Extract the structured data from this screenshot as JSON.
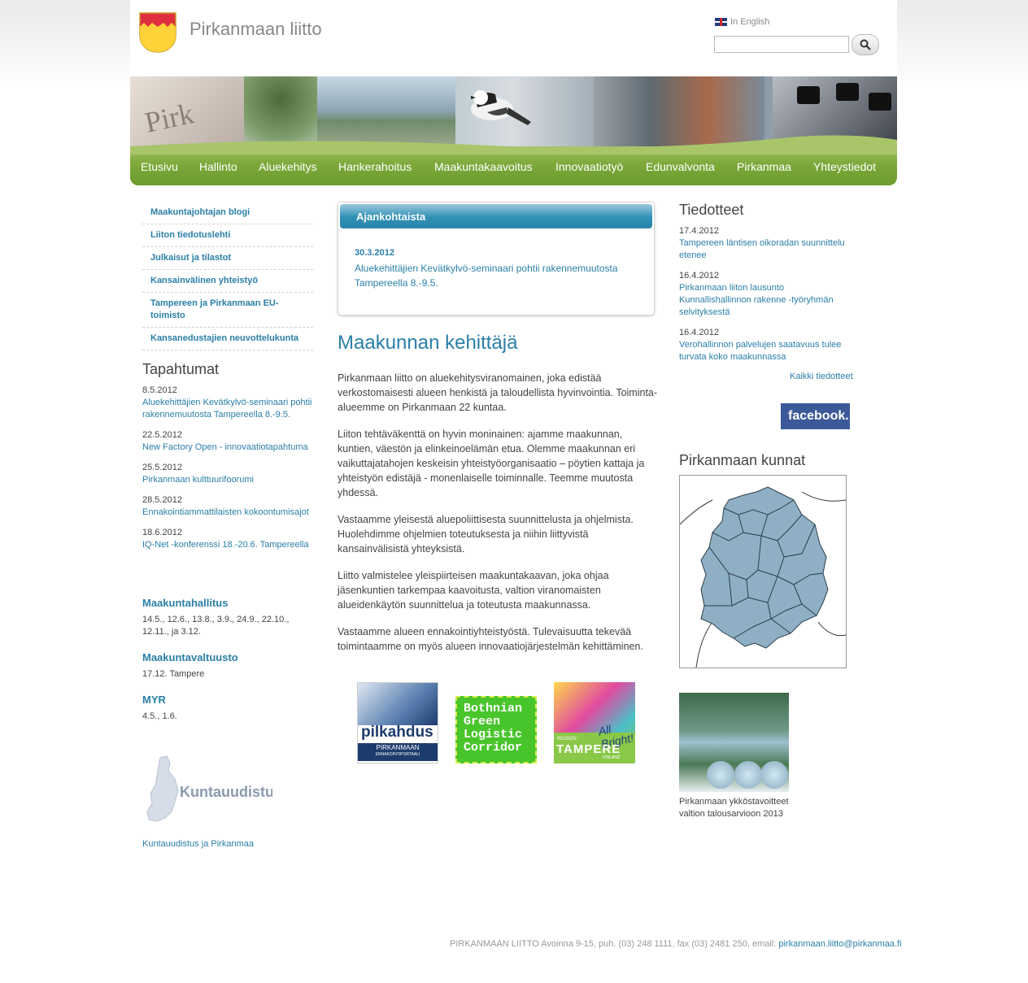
{
  "header": {
    "site_title": "Pirkanmaan liitto",
    "lang_link": "In English",
    "search_placeholder": ""
  },
  "nav": {
    "items": [
      "Etusivu",
      "Hallinto",
      "Aluekehitys",
      "Hankerahoitus",
      "Maakuntakaavoitus",
      "Innovaatiotyö",
      "Edunvalvonta",
      "Pirkanmaa",
      "Yhteystiedot"
    ]
  },
  "left": {
    "links": [
      "Maakuntajohtajan blogi",
      "Liiton tiedotuslehti",
      "Julkaisut ja tilastot",
      "Kansainvälinen yhteistyö",
      "Tampereen ja Pirkanmaan EU-toimisto",
      "Kansanedustajien neuvottelukunta"
    ],
    "events_title": "Tapahtumat",
    "events": [
      {
        "date": "8.5.2012",
        "title": "Aluekehittäjien Kevätkylvö-seminaari pohtii rakennemuutosta Tampereella 8.-9.5."
      },
      {
        "date": "22.5.2012",
        "title": "New Factory Open - innovaatiotapahtuma"
      },
      {
        "date": "25.5.2012",
        "title": "Pirkanmaan kulttuurifoorumi"
      },
      {
        "date": "28.5.2012",
        "title": "Ennakointiammattilaisten kokoontumisajot"
      },
      {
        "date": "18.6.2012",
        "title": "IQ-Net -konferenssi 18.-20.6. Tampereella"
      }
    ],
    "meetings": [
      {
        "title": "Maakuntahallitus",
        "dates": "14.5., 12.6., 13.8., 3.9., 24.9., 22.10., 12.11., ja 3.12."
      },
      {
        "title": "Maakuntavaltuusto",
        "dates": "17.12. Tampere"
      },
      {
        "title": "MYR",
        "dates": "4.5., 1.6."
      }
    ],
    "kunta_image_text": "Kuntauudistus",
    "kunta_link": "Kuntauudistus ja Pirkanmaa"
  },
  "center": {
    "news_header": "Ajankohtaista",
    "news_date": "30.3.2012",
    "news_text": "Aluekehittäjien Kevätkylvö-seminaari pohtii rakennemuutosta Tampereella 8.-9.5.",
    "main_heading": "Maakunnan kehittäjä",
    "paragraphs": [
      "Pirkanmaan liitto on aluekehitysviranomainen, joka edistää verkostomaisesti alueen henkistä ja taloudellista hyvinvointia. Toiminta-alueemme on Pirkanmaan 22 kuntaa.",
      "Liiton tehtäväkenttä on hyvin moninainen: ajamme maakunnan, kuntien, väestön ja elinkeinoelämän etua. Olemme maakunnan eri vaikuttajatahojen keskeisin yhteistyöorganisaatio – pöytien kattaja ja yhteistyön edistäjä - monenlaiselle toiminnalle. Teemme muutosta yhdessä.",
      "Vastaamme yleisestä aluepoliittisesta suunnittelusta ja ohjelmista. Huolehdimme ohjelmien toteutuksesta ja niihin liittyvistä kansainvälisistä yhteyksistä.",
      "Liitto valmistelee yleispiirteisen maakuntakaavan, joka ohjaa jäsenkuntien tarkempaa kaavoitusta, valtion viranomaisten alueidenkäytön suunnittelua ja toteutusta maakunnassa.",
      "Vastaamme alueen ennakointiyhteistyöstä. Tulevaisuutta tekevää toimintaamme on myös alueen innovaatiojärjestelmän kehittäminen."
    ],
    "logos": {
      "pilkahdus_name": "pilkahdus",
      "pilkahdus_sub": "PIRKANMAAN",
      "pilkahdus_sub2": "ENNAKOINTIPORTAALI",
      "bgl_text": "Bothnian Green Logistic Corridor",
      "tampere_region": "REGION",
      "tampere_name": "TAMPERE",
      "tampere_country": "FINLAND",
      "tampere_slogan": "All Bright!"
    }
  },
  "right": {
    "press_title": "Tiedotteet",
    "press": [
      {
        "date": "17.4.2012",
        "title": "Tampereen läntisen oikoradan suunnittelu etenee"
      },
      {
        "date": "16.4.2012",
        "title": "Pirkanmaan liiton lausunto Kunnallishallinnon rakenne -työryhmän selvityksestä"
      },
      {
        "date": "16.4.2012",
        "title": "Verohallinnon palvelujen saatavuus tulee turvata koko maakunnassa"
      }
    ],
    "all_press": "Kaikki tiedotteet",
    "facebook": "facebook.",
    "municipalities_title": "Pirkanmaan kunnat",
    "cover_caption": "Pirkanmaan ykköstavoitteet valtion talousarvioon 2013"
  },
  "footer": {
    "address": "PIRKANMAAN LIITTO Avoinna 9-15, puh. (03) 248 1111, fax (03) 2481 250, email: ",
    "email": "pirkanmaan.liitto@pirkanmaa.fi"
  },
  "colors": {
    "link": "#2a7fa8",
    "nav_green": "#7faa3c",
    "news_header_blue": "#2f8fb5",
    "facebook_blue": "#3b5998",
    "map_fill": "#8fb0c4"
  }
}
